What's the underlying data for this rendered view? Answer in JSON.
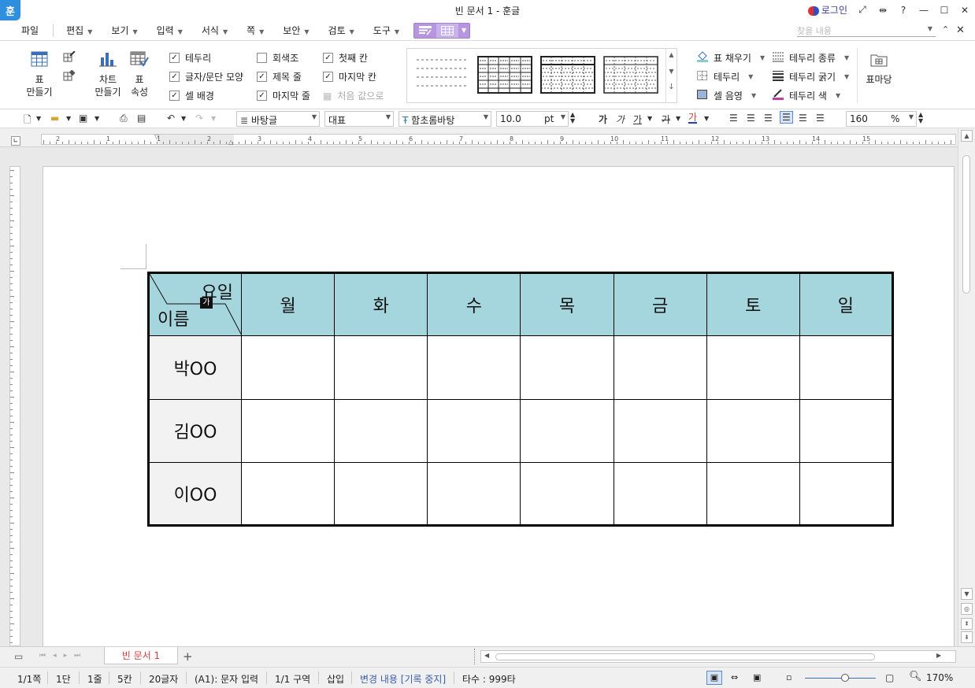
{
  "window": {
    "app_icon": "훈",
    "title": "빈 문서 1 - 훈글",
    "login_label": "로그인",
    "help": "?"
  },
  "menu": {
    "items": [
      "파일",
      "편집",
      "보기",
      "입력",
      "서식",
      "쪽",
      "보안",
      "검토",
      "도구"
    ],
    "search_placeholder": "찾을 내용"
  },
  "ribbon": {
    "table_make": "표\n만들기",
    "table_make_line1": "표",
    "table_make_line2": "만들기",
    "chart_line1": "차트",
    "chart_line2": "만들기",
    "props_line1": "표",
    "props_line2": "속성",
    "checks": [
      {
        "label": "테두리",
        "checked": true
      },
      {
        "label": "글자/문단 모양",
        "checked": true
      },
      {
        "label": "셀 배경",
        "checked": true
      },
      {
        "label": "회색조",
        "checked": false
      },
      {
        "label": "제목 줄",
        "checked": true
      },
      {
        "label": "마지막 줄",
        "checked": true
      },
      {
        "label": "첫째 칸",
        "checked": true
      },
      {
        "label": "마지막 칸",
        "checked": true
      }
    ],
    "reset_label": "처음 값으로",
    "fill_label": "표 채우기",
    "border_label": "테두리",
    "cell_shade_label": "셀 음영",
    "border_type_label": "테두리 종류",
    "border_width_label": "테두리 굵기",
    "border_color_label": "테두리 색",
    "table_bookmark_label": "표마당"
  },
  "toolbar": {
    "style": "바탕글",
    "lang": "대표",
    "font": "함초롬바탕",
    "size": "10.0",
    "size_unit": "pt",
    "zoom": "160",
    "zoom_unit": "%",
    "font_glyph_bold": "가",
    "font_glyph_italic": "가",
    "font_glyph_under": "가",
    "font_glyph_strike": "가",
    "font_glyph_color": "가"
  },
  "ruler": {
    "labels": [
      "2",
      "1",
      "1",
      "2",
      "3",
      "4",
      "5",
      "6",
      "7",
      "8",
      "9",
      "10",
      "11",
      "12",
      "13",
      "14",
      "15"
    ]
  },
  "table": {
    "corner_top": "요일",
    "corner_bottom": "이름",
    "corner_marker": "가",
    "days": [
      "월",
      "화",
      "수",
      "목",
      "금",
      "토",
      "일"
    ],
    "names": [
      "박OO",
      "김OO",
      "이OO"
    ],
    "colors": {
      "header_bg": "#a6d6dd",
      "name_bg": "#f2f2f2"
    }
  },
  "tabs": {
    "doc_tab": "빈 문서 1",
    "add": "+"
  },
  "status": {
    "page": "1/1쪽",
    "column": "1단",
    "line": "1줄",
    "col_pos": "5칸",
    "chars": "20글자",
    "cell": "(A1): 문자 입력",
    "section": "1/1 구역",
    "insert": "삽입",
    "track": "변경 내용 [기록 중지]",
    "typing": "타수 : 999타",
    "zoom": "170%"
  }
}
